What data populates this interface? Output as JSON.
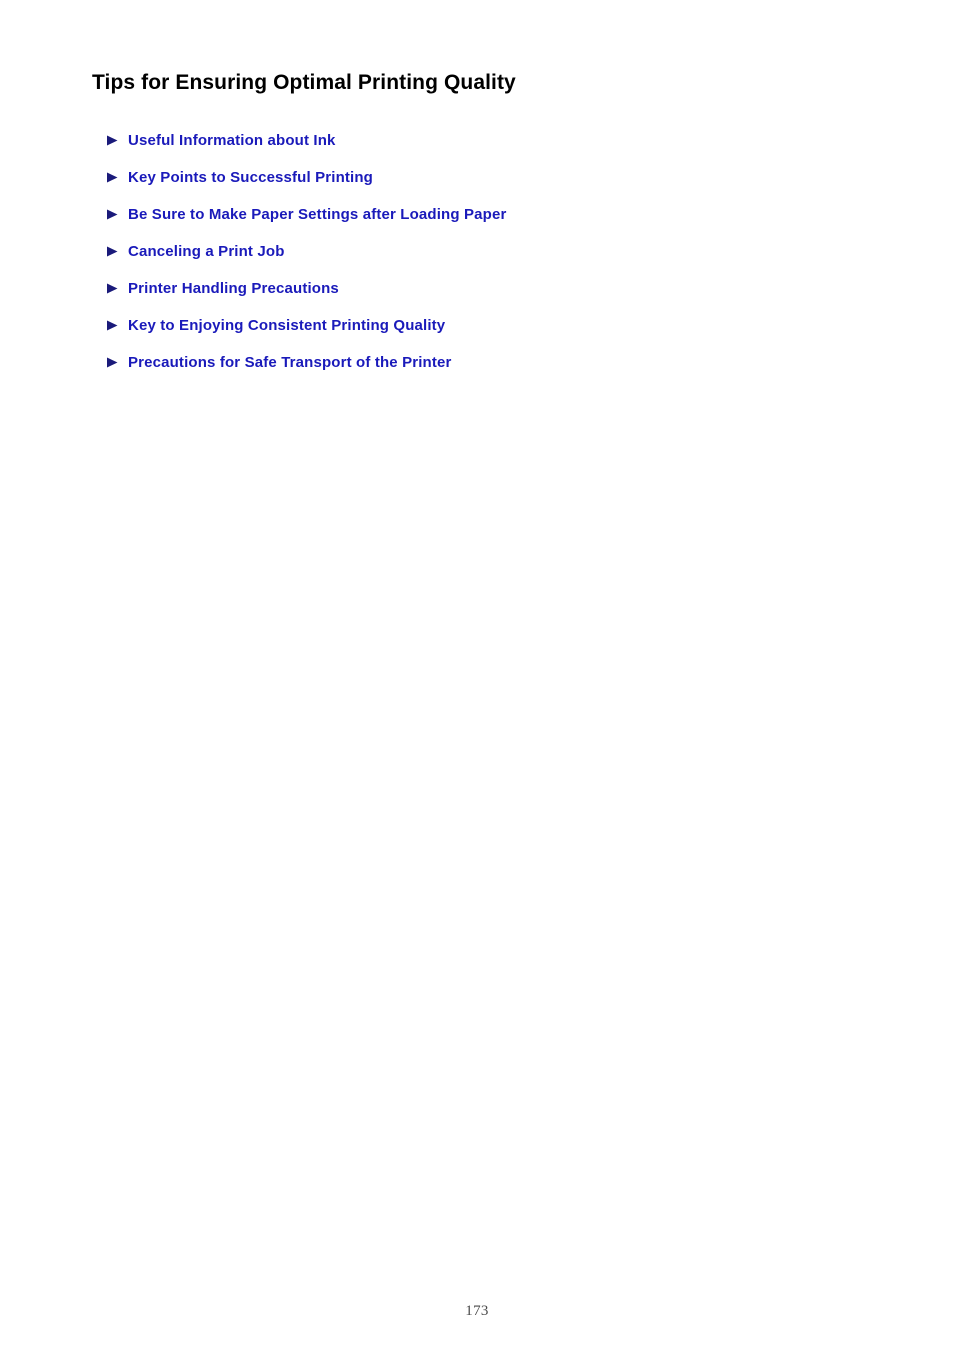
{
  "document": {
    "title": "Tips for Ensuring Optimal Printing Quality",
    "page_number": "173",
    "link_color": "#1a1aba",
    "title_color": "#000000",
    "bullet_color": "#1a1a7a",
    "background_color": "#ffffff"
  },
  "links": [
    {
      "label": "Useful Information about Ink",
      "bullet": "triangle-right-icon"
    },
    {
      "label": "Key Points to Successful Printing",
      "bullet": "triangle-right-icon"
    },
    {
      "label": "Be Sure to Make Paper Settings after Loading Paper",
      "bullet": "triangle-right-icon"
    },
    {
      "label": "Canceling a Print Job",
      "bullet": "triangle-right-icon"
    },
    {
      "label": "Printer Handling Precautions",
      "bullet": "triangle-right-icon"
    },
    {
      "label": "Key to Enjoying Consistent Printing Quality",
      "bullet": "triangle-right-icon"
    },
    {
      "label": "Precautions for Safe Transport of the Printer",
      "bullet": "triangle-right-icon"
    }
  ]
}
